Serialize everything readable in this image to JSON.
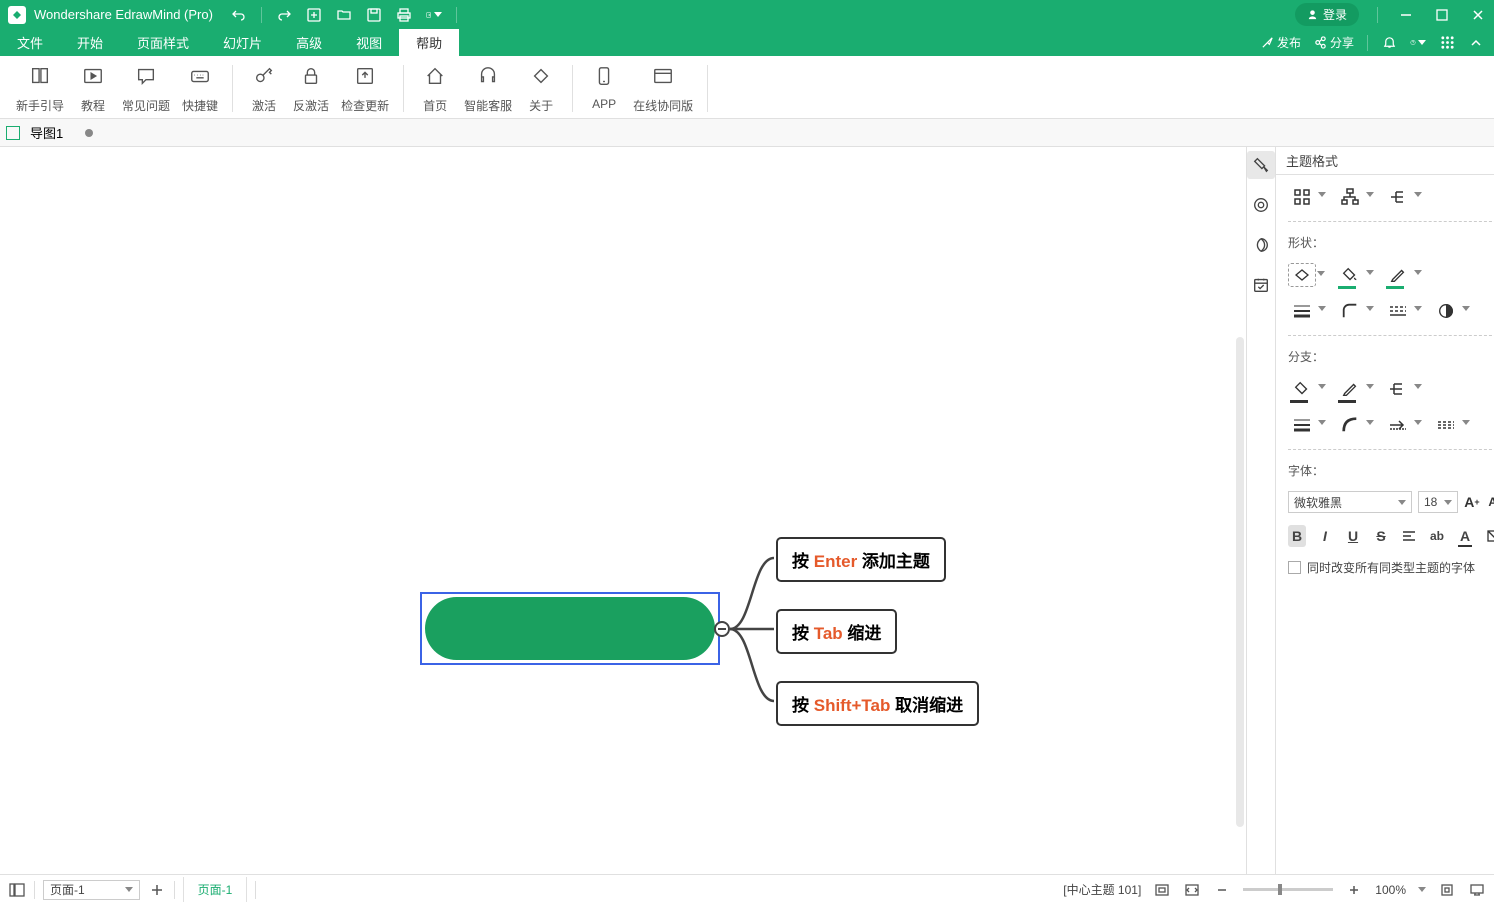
{
  "titlebar": {
    "app_name": "Wondershare EdrawMind (Pro)",
    "login": "登录"
  },
  "menubar": {
    "items": [
      "文件",
      "开始",
      "页面样式",
      "幻灯片",
      "高级",
      "视图",
      "帮助"
    ],
    "active_index": 6,
    "right": {
      "publish": "发布",
      "share": "分享"
    }
  },
  "ribbon": {
    "groups": [
      [
        "新手引导",
        "教程",
        "常见问题",
        "快捷键"
      ],
      [
        "激活",
        "反激活",
        "检查更新"
      ],
      [
        "首页",
        "智能客服",
        "关于"
      ],
      [
        "APP",
        "在线协同版"
      ]
    ]
  },
  "doctabs": {
    "tab1": "导图1"
  },
  "mindmap": {
    "subs": [
      {
        "pre": "按 ",
        "accent": "Enter",
        "post": " 添加主题"
      },
      {
        "pre": "按 ",
        "accent": "Tab",
        "post": " 缩进"
      },
      {
        "pre": "按 ",
        "accent": "Shift+Tab",
        "post": " 取消缩进"
      }
    ]
  },
  "right_panel": {
    "title": "主题格式",
    "shape_label": "形状：",
    "branch_label": "分支：",
    "font_label": "字体：",
    "font_name": "微软雅黑",
    "font_size": "18",
    "apply_similar": "同时改变所有同类型主题的字体"
  },
  "statusbar": {
    "page_select": "页面-1",
    "page_tab": "页面-1",
    "status": "[中心主题 101]",
    "zoom": "100%"
  }
}
